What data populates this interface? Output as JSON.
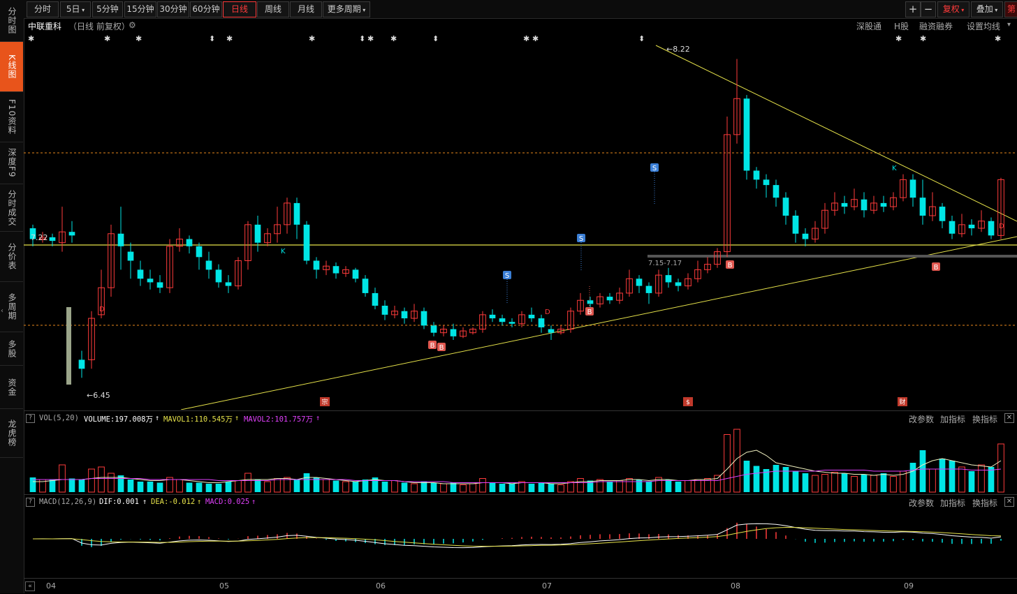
{
  "leftnav": [
    {
      "label": "分时图",
      "active": false
    },
    {
      "label": "K线图",
      "active": true
    },
    {
      "label": "F10资料",
      "active": false
    },
    {
      "label": "深度F9",
      "active": false
    },
    {
      "label": "分时成交",
      "active": false
    },
    {
      "label": "分价表",
      "active": false
    },
    {
      "label": "多周期",
      "active": false
    },
    {
      "label": "多股",
      "active": false
    },
    {
      "label": "资金",
      "active": false
    },
    {
      "label": "龙虎榜",
      "active": false
    }
  ],
  "toolbar": {
    "periods": [
      {
        "label": "分时",
        "active": false
      },
      {
        "label": "5日",
        "active": false,
        "dropdown": true
      },
      {
        "label": "5分钟",
        "active": false
      },
      {
        "label": "15分钟",
        "active": false
      },
      {
        "label": "30分钟",
        "active": false
      },
      {
        "label": "60分钟",
        "active": false
      },
      {
        "label": "日线",
        "active": true
      },
      {
        "label": "周线",
        "active": false
      },
      {
        "label": "月线",
        "active": false
      },
      {
        "label": "更多周期",
        "active": false,
        "dropdown": true
      }
    ],
    "zoom_in": "+",
    "zoom_out": "−",
    "fuquan": "复权",
    "overlay": "叠加",
    "cut": "第"
  },
  "title": {
    "name": "中联重科",
    "sub": "（日线 前复权）",
    "links": [
      "深股通",
      "H股",
      "融资融券",
      "设置均线"
    ]
  },
  "annotations": {
    "high": "8.22",
    "low": "6.45",
    "left_price": "7.22",
    "range": "7.15-7.17",
    "marks": {
      "K": "K",
      "D": "D",
      "S": "S",
      "B": "B",
      "BB": "B"
    },
    "events": [
      "宗",
      "$",
      "财"
    ]
  },
  "vol": {
    "label": "VOL(5,20)",
    "volume": "VOLUME:197.008万",
    "mavol1": "MAVOL1:110.545万",
    "mavol2": "MAVOL2:101.757万",
    "buttons": [
      "改参数",
      "加指标",
      "换指标"
    ]
  },
  "macd": {
    "label": "MACD(12,26,9)",
    "dif": "DIF:0.001",
    "dea": "DEA:-0.012",
    "macd": "MACD:0.025",
    "buttons": [
      "改参数",
      "加指标",
      "换指标"
    ]
  },
  "xaxis": [
    "04",
    "05",
    "06",
    "07",
    "08",
    "09"
  ],
  "colors": {
    "up": "#ff3b3b",
    "down": "#00e5e5",
    "accent": "#e8541b",
    "trend": "#e6e24a",
    "mavol2": "#e040fb"
  },
  "chart_data": {
    "type": "candlestick",
    "price_high": 8.22,
    "price_low": 6.45,
    "candles": [
      [
        7.28,
        7.22,
        7.3,
        7.18
      ],
      [
        7.22,
        7.23,
        7.26,
        7.2
      ],
      [
        7.23,
        7.21,
        7.25,
        7.18
      ],
      [
        7.2,
        7.26,
        7.4,
        7.15
      ],
      [
        7.26,
        7.24,
        7.32,
        7.2
      ],
      [
        6.55,
        6.5,
        6.6,
        6.45
      ],
      [
        6.55,
        6.78,
        6.82,
        6.5
      ],
      [
        6.8,
        6.95,
        7.05,
        6.78
      ],
      [
        6.95,
        7.25,
        7.3,
        6.9
      ],
      [
        7.25,
        7.18,
        7.4,
        7.05
      ],
      [
        7.15,
        7.1,
        7.2,
        7.0
      ],
      [
        7.05,
        7.0,
        7.1,
        6.96
      ],
      [
        7.0,
        6.98,
        7.05,
        6.94
      ],
      [
        6.98,
        6.95,
        7.02,
        6.92
      ],
      [
        6.95,
        7.18,
        7.22,
        6.92
      ],
      [
        7.18,
        7.22,
        7.28,
        7.15
      ],
      [
        7.22,
        7.18,
        7.24,
        7.14
      ],
      [
        7.18,
        7.12,
        7.2,
        7.05
      ],
      [
        7.1,
        7.05,
        7.15,
        7.0
      ],
      [
        7.05,
        6.98,
        7.08,
        6.95
      ],
      [
        6.98,
        6.96,
        7.02,
        6.92
      ],
      [
        6.96,
        7.1,
        7.12,
        6.94
      ],
      [
        7.1,
        7.3,
        7.32,
        7.05
      ],
      [
        7.3,
        7.2,
        7.35,
        7.15
      ],
      [
        7.2,
        7.25,
        7.28,
        7.18
      ],
      [
        7.25,
        7.3,
        7.4,
        7.2
      ],
      [
        7.3,
        7.42,
        7.45,
        7.25
      ],
      [
        7.42,
        7.3,
        7.45,
        7.22
      ],
      [
        7.3,
        7.1,
        7.32,
        7.08
      ],
      [
        7.1,
        7.05,
        7.12,
        7.0
      ],
      [
        7.05,
        7.07,
        7.1,
        7.02
      ],
      [
        7.07,
        7.03,
        7.09,
        7.0
      ],
      [
        7.03,
        7.05,
        7.07,
        7.01
      ],
      [
        7.05,
        7.0,
        7.06,
        6.98
      ],
      [
        7.0,
        6.92,
        7.02,
        6.9
      ],
      [
        6.92,
        6.85,
        6.95,
        6.83
      ],
      [
        6.85,
        6.8,
        6.88,
        6.77
      ],
      [
        6.8,
        6.82,
        6.85,
        6.78
      ],
      [
        6.82,
        6.78,
        6.84,
        6.75
      ],
      [
        6.78,
        6.82,
        6.86,
        6.76
      ],
      [
        6.82,
        6.74,
        6.84,
        6.72
      ],
      [
        6.74,
        6.7,
        6.76,
        6.68
      ],
      [
        6.7,
        6.72,
        6.74,
        6.68
      ],
      [
        6.72,
        6.68,
        6.75,
        6.66
      ],
      [
        6.68,
        6.71,
        6.73,
        6.67
      ],
      [
        6.7,
        6.72,
        6.73,
        6.69
      ],
      [
        6.72,
        6.8,
        6.82,
        6.7
      ],
      [
        6.8,
        6.78,
        6.83,
        6.76
      ],
      [
        6.78,
        6.76,
        6.8,
        6.74
      ],
      [
        6.76,
        6.75,
        6.78,
        6.73
      ],
      [
        6.75,
        6.8,
        6.82,
        6.73
      ],
      [
        6.8,
        6.78,
        6.84,
        6.76
      ],
      [
        6.78,
        6.73,
        6.8,
        6.7
      ],
      [
        6.72,
        6.7,
        6.74,
        6.66
      ],
      [
        6.7,
        6.72,
        6.74,
        6.69
      ],
      [
        6.72,
        6.82,
        6.84,
        6.7
      ],
      [
        6.82,
        6.88,
        6.92,
        6.8
      ],
      [
        6.88,
        6.86,
        6.9,
        6.83
      ],
      [
        6.86,
        6.9,
        6.92,
        6.84
      ],
      [
        6.9,
        6.88,
        6.92,
        6.86
      ],
      [
        6.88,
        6.92,
        6.95,
        6.86
      ],
      [
        6.92,
        7.0,
        7.05,
        6.9
      ],
      [
        7.0,
        6.96,
        7.02,
        6.92
      ],
      [
        6.96,
        6.92,
        6.98,
        6.86
      ],
      [
        6.92,
        7.02,
        7.05,
        6.9
      ],
      [
        7.02,
        6.98,
        7.06,
        6.95
      ],
      [
        6.98,
        6.96,
        7.0,
        6.93
      ],
      [
        6.96,
        7.0,
        7.03,
        6.94
      ],
      [
        7.0,
        7.05,
        7.1,
        6.98
      ],
      [
        7.05,
        7.08,
        7.12,
        7.03
      ]
    ],
    "extra_candles": [
      [
        7.08,
        7.15,
        7.17,
        7.06
      ],
      [
        7.15,
        7.8,
        7.9,
        7.12
      ],
      [
        7.8,
        8.0,
        8.22,
        7.75
      ],
      [
        8.0,
        7.6,
        8.02,
        7.55
      ],
      [
        7.6,
        7.55,
        7.62,
        7.5
      ],
      [
        7.55,
        7.52,
        7.58,
        7.45
      ],
      [
        7.52,
        7.45,
        7.55,
        7.4
      ],
      [
        7.45,
        7.35,
        7.48,
        7.3
      ],
      [
        7.35,
        7.25,
        7.38,
        7.2
      ],
      [
        7.25,
        7.22,
        7.28,
        7.18
      ],
      [
        7.22,
        7.28,
        7.32,
        7.2
      ],
      [
        7.28,
        7.38,
        7.42,
        7.25
      ],
      [
        7.38,
        7.42,
        7.48,
        7.35
      ],
      [
        7.42,
        7.4,
        7.46,
        7.36
      ],
      [
        7.4,
        7.44,
        7.5,
        7.38
      ],
      [
        7.44,
        7.38,
        7.48,
        7.34
      ],
      [
        7.38,
        7.42,
        7.46,
        7.36
      ],
      [
        7.42,
        7.4,
        7.46,
        7.37
      ],
      [
        7.4,
        7.45,
        7.48,
        7.38
      ],
      [
        7.45,
        7.55,
        7.58,
        7.43
      ],
      [
        7.55,
        7.45,
        7.58,
        7.4
      ],
      [
        7.45,
        7.35,
        7.55,
        7.3
      ],
      [
        7.35,
        7.4,
        7.48,
        7.32
      ],
      [
        7.4,
        7.32,
        7.42,
        7.28
      ],
      [
        7.32,
        7.25,
        7.35,
        7.22
      ],
      [
        7.25,
        7.3,
        7.36,
        7.23
      ],
      [
        7.3,
        7.28,
        7.33,
        7.24
      ],
      [
        7.28,
        7.32,
        7.38,
        7.26
      ],
      [
        7.32,
        7.24,
        7.34,
        7.22
      ],
      [
        7.24,
        7.55,
        7.56,
        7.22
      ]
    ],
    "volume": [
      14,
      12,
      12,
      26,
      13,
      12,
      22,
      24,
      18,
      16,
      12,
      10,
      10,
      9,
      14,
      12,
      9,
      9,
      8,
      8,
      10,
      11,
      18,
      12,
      10,
      13,
      14,
      12,
      18,
      14,
      12,
      11,
      10,
      10,
      12,
      14,
      10,
      11,
      9,
      8,
      10,
      9,
      8,
      9,
      7,
      8,
      13,
      9,
      8,
      8,
      10,
      8,
      9,
      8,
      7,
      10,
      13,
      11,
      12,
      10,
      11,
      13,
      12,
      10,
      14,
      12,
      10,
      11,
      12,
      13,
      16,
      55,
      60,
      30,
      25,
      22,
      26,
      24,
      20,
      18,
      16,
      17,
      19,
      18,
      15,
      17,
      16,
      18,
      15,
      20,
      28,
      40,
      22,
      32,
      30,
      24,
      20,
      26,
      24,
      46
    ],
    "mavol1": [
      10,
      10,
      11,
      12,
      12,
      12,
      13,
      14,
      14,
      14,
      13,
      12,
      11,
      11,
      12,
      12,
      11,
      10,
      9,
      9,
      10,
      11,
      12,
      12,
      12,
      13,
      13,
      12,
      14,
      14,
      13,
      12,
      11,
      10,
      11,
      12,
      11,
      11,
      10,
      9,
      9,
      9,
      8,
      8,
      8,
      8,
      9,
      9,
      9,
      8,
      9,
      9,
      9,
      8,
      8,
      9,
      10,
      10,
      11,
      11,
      11,
      12,
      12,
      11,
      12,
      12,
      11,
      11,
      12,
      12,
      13,
      22,
      32,
      38,
      40,
      35,
      28,
      26,
      24,
      22,
      20,
      19,
      18,
      18,
      17,
      17,
      16,
      17,
      16,
      17,
      20,
      26,
      30,
      32,
      30,
      28,
      26,
      25,
      24,
      30
    ],
    "mavol2": [
      12,
      12,
      12,
      12,
      12,
      12,
      13,
      13,
      13,
      13,
      13,
      13,
      12,
      12,
      12,
      12,
      12,
      12,
      12,
      11,
      11,
      11,
      11,
      11,
      11,
      12,
      12,
      12,
      12,
      12,
      12,
      12,
      12,
      11,
      11,
      11,
      11,
      11,
      10,
      10,
      10,
      10,
      10,
      9,
      9,
      9,
      9,
      9,
      9,
      9,
      9,
      9,
      9,
      9,
      9,
      9,
      9,
      9,
      10,
      10,
      10,
      10,
      10,
      10,
      11,
      11,
      11,
      11,
      11,
      11,
      11,
      13,
      15,
      17,
      18,
      19,
      20,
      20,
      20,
      20,
      20,
      21,
      21,
      21,
      21,
      21,
      20,
      20,
      20,
      20,
      21,
      22,
      22,
      22,
      22,
      22,
      21,
      21,
      21,
      22
    ]
  }
}
